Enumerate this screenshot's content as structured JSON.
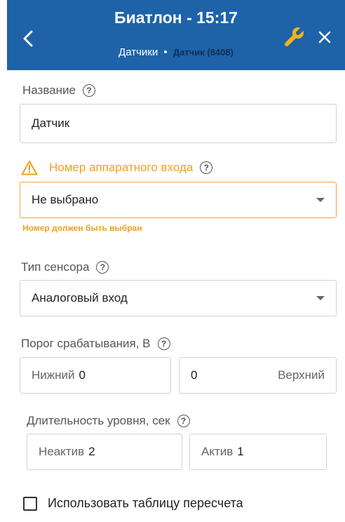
{
  "header": {
    "title": "Биатлон - 15:17",
    "breadcrumb_section": "Датчики",
    "breadcrumb_separator": "•",
    "breadcrumb_item": "Датчик (8408)"
  },
  "form": {
    "name": {
      "label": "Название",
      "value": "Датчик"
    },
    "hardware_input": {
      "label": "Номер аппаратного входа",
      "value": "Не выбрано",
      "error": "Номер должен быть выбран"
    },
    "sensor_type": {
      "label": "Тип сенсора",
      "value": "Аналоговый вход"
    },
    "threshold": {
      "label": "Порог срабатывания, В",
      "lower_label": "Нижний",
      "lower_value": "0",
      "upper_label": "Верхний",
      "upper_value": "0"
    },
    "level_duration": {
      "label": "Длительность уровня, сек",
      "inactive_label": "Неактив",
      "inactive_value": "2",
      "active_label": "Актив",
      "active_value": "1"
    },
    "recalc_table": {
      "label": "Использовать таблицу пересчета",
      "checked": false
    }
  },
  "colors": {
    "header_bg": "#1e63a8",
    "wrench": "#f5b21a",
    "warning": "#f0a020"
  }
}
